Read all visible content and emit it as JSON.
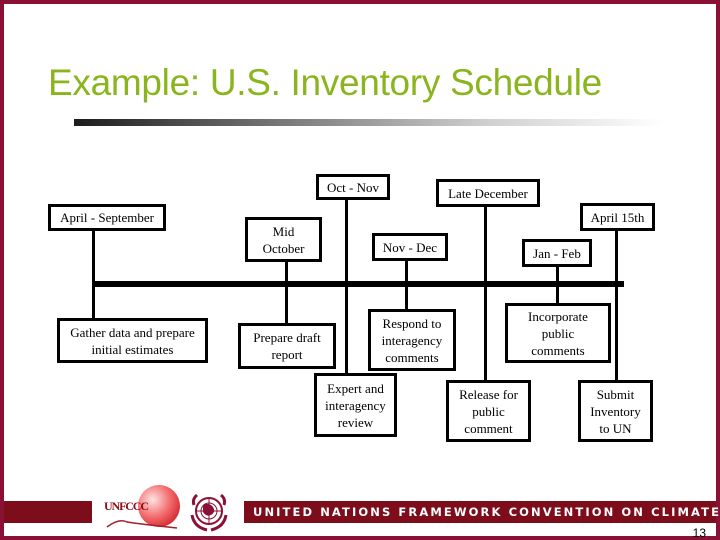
{
  "slide": {
    "title": "Example: U.S. Inventory Schedule",
    "page_number": "13",
    "colors": {
      "frame": "#8b1036",
      "title": "#8bb51e",
      "footer_band": "#7e0d1c"
    }
  },
  "timeline": {
    "dates": [
      {
        "id": "april-september",
        "label": "April - September"
      },
      {
        "id": "mid-october",
        "label": "Mid\nOctober"
      },
      {
        "id": "oct-nov",
        "label": "Oct - Nov"
      },
      {
        "id": "nov-dec",
        "label": "Nov - Dec"
      },
      {
        "id": "late-december",
        "label": "Late December"
      },
      {
        "id": "jan-feb",
        "label": "Jan - Feb"
      },
      {
        "id": "april-15th",
        "label": "April 15th"
      }
    ],
    "activities": [
      {
        "id": "gather-data",
        "label": "Gather data and prepare\ninitial estimates"
      },
      {
        "id": "prepare-draft",
        "label": "Prepare draft\nreport"
      },
      {
        "id": "expert-review",
        "label": "Expert and\ninteragency\nreview"
      },
      {
        "id": "respond-comments",
        "label": "Respond to\ninteragency\ncomments"
      },
      {
        "id": "release-public",
        "label": "Release for\npublic\ncomment"
      },
      {
        "id": "incorporate-public",
        "label": "Incorporate\npublic\ncomments"
      },
      {
        "id": "submit-inventory",
        "label": "Submit\nInventory\nto UN"
      }
    ]
  },
  "footer": {
    "banner_text": "UNITED NATIONS FRAMEWORK CONVENTION ON CLIMATE CHANGE",
    "unfccc_logo_text": "UNFCCC",
    "logos": [
      "unfccc-logo",
      "un-emblem-logo"
    ]
  }
}
